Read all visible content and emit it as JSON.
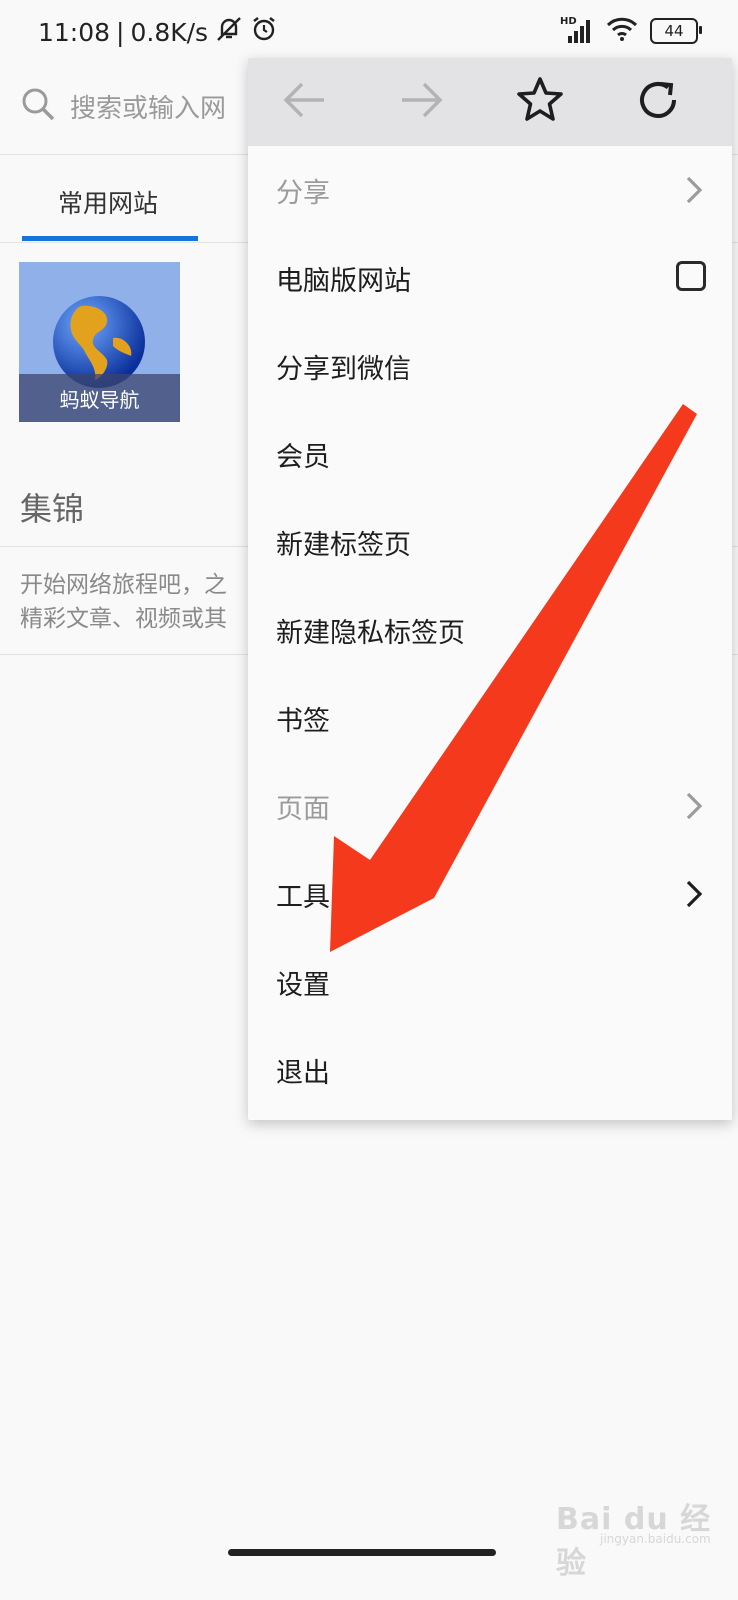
{
  "status_bar": {
    "time": "11:08",
    "separator": "|",
    "speed": "0.8K/s",
    "hd_label": "HD",
    "battery": "44"
  },
  "search": {
    "placeholder": "搜索或输入网"
  },
  "tabs": {
    "active_label": "常用网站"
  },
  "tiles": [
    {
      "label": "蚂蚁导航"
    }
  ],
  "collections": {
    "title": "集锦",
    "intro_line1": "开始网络旅程吧，之",
    "intro_line2": "精彩文章、视频或其"
  },
  "menu": {
    "toolbar": {
      "back_icon": "arrow-left-icon",
      "forward_icon": "arrow-right-icon",
      "bookmark_icon": "star-icon",
      "reload_icon": "refresh-icon"
    },
    "items": [
      {
        "label": "分享",
        "disabled": true,
        "has_submenu": true
      },
      {
        "label": "电脑版网站",
        "disabled": false,
        "has_checkbox": true,
        "checked": false
      },
      {
        "label": "分享到微信",
        "disabled": false
      },
      {
        "label": "会员",
        "disabled": false
      },
      {
        "label": "新建标签页",
        "disabled": false
      },
      {
        "label": "新建隐私标签页",
        "disabled": false
      },
      {
        "label": "书签",
        "disabled": false
      },
      {
        "label": "页面",
        "disabled": true,
        "has_submenu": true
      },
      {
        "label": "工具",
        "disabled": false,
        "has_submenu": true
      },
      {
        "label": "设置",
        "disabled": false
      },
      {
        "label": "退出",
        "disabled": false
      }
    ]
  },
  "annotation": {
    "color": "#f5391c"
  },
  "watermark": {
    "text": "Bai du 经验",
    "sub": "jingyan.baidu.com"
  },
  "colors": {
    "accent": "#1277d9",
    "menu_toolbar": "#e3e3e6"
  }
}
